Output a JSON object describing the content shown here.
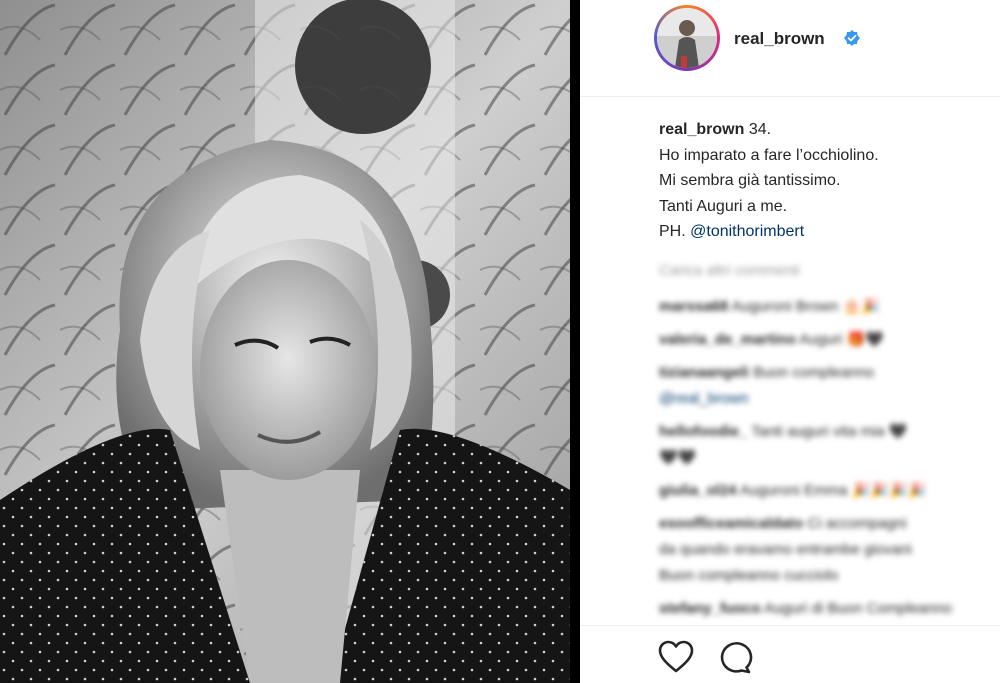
{
  "post": {
    "username": "real_brown",
    "verified_icon": "verified-badge-icon",
    "photo_icon": "portrait-photo",
    "caption": {
      "author": "real_brown",
      "line1": "34.",
      "line2": "Ho imparato a fare l’occhiolino.",
      "line3": "Mi sembra già tantissimo.",
      "line4": "Tanti Auguri a me.",
      "line5_prefix": "PH.",
      "mention": "@tonithorimbert"
    },
    "comments": {
      "load_more": "Carica altri commenti",
      "items": [
        {
          "user": "marssa68",
          "text": "Auguroni Brown 🎂🎉"
        },
        {
          "user": "valeria_de_martino",
          "text": "Auguri 🎁🖤"
        },
        {
          "user": "tizianaangeli",
          "text": "Buon compleanno"
        },
        {
          "user": "",
          "text": "@real_brown"
        },
        {
          "user": "hellofoodie_",
          "text": "Tanti auguri vita mia 🖤"
        },
        {
          "user": "",
          "text": "🖤🖤"
        },
        {
          "user": "giulia_ol24",
          "text": "Auguroni Emma 🎉🎉🎉🎉"
        },
        {
          "user": "esoofficeamicaldato",
          "text": "Ci accompagni"
        },
        {
          "user": "",
          "text": "da quando eravamo entrambe giovani"
        },
        {
          "user": "",
          "text": "Buon compleanno cucciolo"
        },
        {
          "user": "stefany_fuoco",
          "text": "Auguri di Buon Compleanno"
        }
      ]
    },
    "actions": {
      "like_icon": "heart-icon",
      "comment_icon": "comment-icon"
    }
  }
}
